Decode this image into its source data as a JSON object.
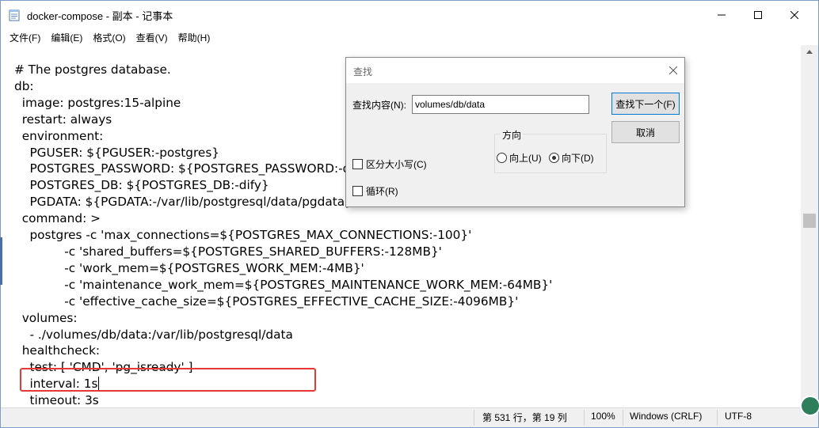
{
  "window": {
    "title": "docker-compose - 副本 - 记事本"
  },
  "menu": [
    {
      "label": "文件(F)"
    },
    {
      "label": "编辑(E)"
    },
    {
      "label": "格式(O)"
    },
    {
      "label": "查看(V)"
    },
    {
      "label": "帮助(H)"
    }
  ],
  "editor": {
    "lines": [
      "# The postgres database.",
      "db:",
      "  image: postgres:15-alpine",
      "  restart: always",
      "  environment:",
      "    PGUSER: ${PGUSER:-postgres}",
      "    POSTGRES_PASSWORD: ${POSTGRES_PASSWORD:-d",
      "    POSTGRES_DB: ${POSTGRES_DB:-dify}",
      "    PGDATA: ${PGDATA:-/var/lib/postgresql/data/pgdata}",
      "  command: >",
      "    postgres -c 'max_connections=${POSTGRES_MAX_CONNECTIONS:-100}'",
      "             -c 'shared_buffers=${POSTGRES_SHARED_BUFFERS:-128MB}'",
      "             -c 'work_mem=${POSTGRES_WORK_MEM:-4MB}'",
      "             -c 'maintenance_work_mem=${POSTGRES_MAINTENANCE_WORK_MEM:-64MB}'",
      "             -c 'effective_cache_size=${POSTGRES_EFFECTIVE_CACHE_SIZE:-4096MB}'",
      "  volumes:",
      "    - ./volumes/db/data:/var/lib/postgresql/data",
      "  healthcheck:",
      "    test: [ 'CMD', 'pg_isready' ]",
      "    interval: 1s",
      "    timeout: 3s"
    ]
  },
  "status": {
    "position": "第 531 行，第 19 列",
    "zoom": "100%",
    "line_ending": "Windows (CRLF)",
    "encoding": "UTF-8"
  },
  "find_dialog": {
    "title": "查找",
    "find_label": "查找内容(N):",
    "find_value": "volumes/db/data",
    "find_next_label": "查找下一个(F)",
    "cancel_label": "取消",
    "direction_label": "方向",
    "up_label": "向上(U)",
    "down_label": "向下(D)",
    "direction_selected": "down",
    "match_case_label": "区分大小写(C)",
    "wrap_label": "循环(R)"
  },
  "colors": {
    "highlight_box": "#e53935",
    "dialog_bg": "#f0f0f0",
    "primary_button_border": "#0078d7"
  }
}
